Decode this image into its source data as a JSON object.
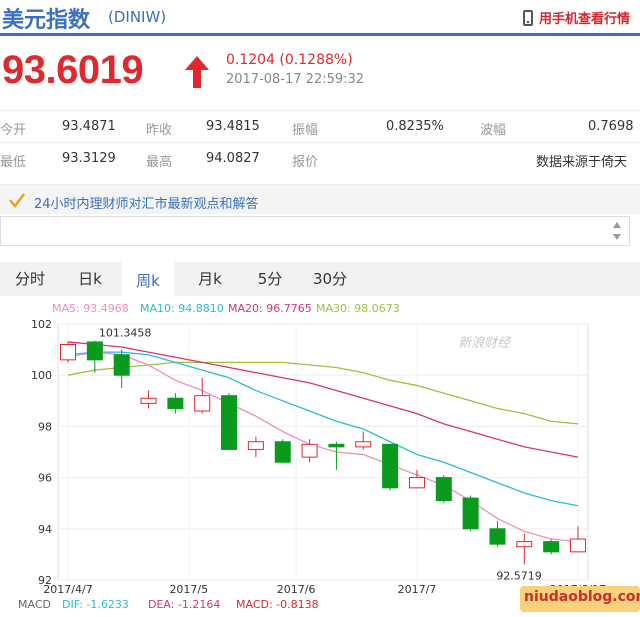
{
  "header": {
    "title": "美元指数",
    "code": "(DINIW)",
    "mobile_link": "用手机查看行情"
  },
  "quote": {
    "price": "93.6019",
    "change": "0.1204 (0.1288%)",
    "time": "2017-08-17 22:59:32",
    "direction": "up"
  },
  "stats": {
    "open_label": "今开",
    "open": "93.4871",
    "prev_close_label": "昨收",
    "prev_close": "93.4815",
    "amplitude_label": "振幅",
    "amplitude": "0.8235%",
    "wave_label": "波幅",
    "wave": "0.7698",
    "low_label": "最低",
    "low": "93.3129",
    "high_label": "最高",
    "high": "94.0827",
    "quote_label": "报价",
    "source": "数据来源于倚天"
  },
  "news": {
    "headline": "24小时内理财师对汇市最新观点和解答"
  },
  "tabs": [
    {
      "label": "分时"
    },
    {
      "label": "日k"
    },
    {
      "label": "周k"
    },
    {
      "label": "月k"
    },
    {
      "label": "5分"
    },
    {
      "label": "30分"
    }
  ],
  "active_tab": 2,
  "legend": {
    "ma5": "MA5: 93.4968",
    "ma10": "MA10: 94.8810",
    "ma20": "MA20: 96.7765",
    "ma30": "MA30: 98.0673"
  },
  "colors": {
    "ma5": "#f08cc0",
    "ma10": "#28bcd8",
    "ma20": "#d8337a",
    "ma30": "#9cc23c",
    "up": "#e0282e",
    "down": "#0a9a1e",
    "accent": "#3b6fbf"
  },
  "watermark": "新浪财经",
  "site_watermark": "niudaoblog.com",
  "macd": {
    "label": "MACD",
    "dif": "DIF: -1.6233",
    "dea": "DEA: -1.2164",
    "macd": "MACD: -0.8138"
  },
  "chart_data": {
    "type": "candlestick",
    "ylim": [
      92,
      102
    ],
    "yticks": [
      "102",
      "100",
      "98",
      "96",
      "94",
      "92"
    ],
    "x_labels": [
      "2017/4/7",
      "2017/5",
      "2017/6",
      "2017/7",
      "2017/8/17"
    ],
    "annotations": {
      "high": "101.3458",
      "low": "92.5719"
    },
    "candles": [
      {
        "o": 100.6,
        "c": 101.2,
        "h": 101.3,
        "l": 100.5
      },
      {
        "o": 101.3,
        "c": 100.6,
        "h": 101.35,
        "l": 100.1
      },
      {
        "o": 100.8,
        "c": 100.0,
        "h": 101.0,
        "l": 99.5
      },
      {
        "o": 98.9,
        "c": 99.1,
        "h": 99.4,
        "l": 98.7
      },
      {
        "o": 99.1,
        "c": 98.7,
        "h": 99.3,
        "l": 98.5
      },
      {
        "o": 98.6,
        "c": 99.2,
        "h": 99.9,
        "l": 98.5
      },
      {
        "o": 99.2,
        "c": 97.1,
        "h": 99.3,
        "l": 97.1
      },
      {
        "o": 97.1,
        "c": 97.4,
        "h": 97.6,
        "l": 96.8
      },
      {
        "o": 97.4,
        "c": 96.6,
        "h": 97.5,
        "l": 96.6
      },
      {
        "o": 96.8,
        "c": 97.3,
        "h": 97.5,
        "l": 96.6
      },
      {
        "o": 97.3,
        "c": 97.2,
        "h": 97.4,
        "l": 96.3
      },
      {
        "o": 97.2,
        "c": 97.4,
        "h": 97.8,
        "l": 97.1
      },
      {
        "o": 97.3,
        "c": 95.6,
        "h": 97.3,
        "l": 95.5
      },
      {
        "o": 95.6,
        "c": 96.0,
        "h": 96.3,
        "l": 95.6
      },
      {
        "o": 96.0,
        "c": 95.1,
        "h": 96.1,
        "l": 95.0
      },
      {
        "o": 95.2,
        "c": 94.0,
        "h": 95.3,
        "l": 93.9
      },
      {
        "o": 94.0,
        "c": 93.4,
        "h": 94.3,
        "l": 93.3
      },
      {
        "o": 93.3,
        "c": 93.5,
        "h": 93.8,
        "l": 92.6
      },
      {
        "o": 93.5,
        "c": 93.1,
        "h": 93.6,
        "l": 93.0
      },
      {
        "o": 93.1,
        "c": 93.6,
        "h": 94.1,
        "l": 93.1
      }
    ],
    "ma5": [
      100.7,
      100.9,
      100.8,
      100.4,
      99.8,
      99.4,
      98.9,
      98.4,
      97.8,
      97.3,
      97.0,
      96.9,
      96.5,
      96.1,
      95.7,
      95.1,
      94.4,
      93.9,
      93.6,
      93.5
    ],
    "ma10": [
      100.8,
      100.9,
      100.9,
      100.8,
      100.5,
      100.2,
      99.9,
      99.4,
      99.0,
      98.6,
      98.2,
      97.9,
      97.4,
      96.9,
      96.6,
      96.2,
      95.8,
      95.4,
      95.1,
      94.9
    ],
    "ma20": [
      101.3,
      101.2,
      101.1,
      100.9,
      100.7,
      100.5,
      100.3,
      100.1,
      99.9,
      99.7,
      99.4,
      99.1,
      98.8,
      98.5,
      98.1,
      97.8,
      97.5,
      97.2,
      97.0,
      96.8
    ],
    "ma30": [
      100.0,
      100.2,
      100.3,
      100.4,
      100.5,
      100.5,
      100.5,
      100.5,
      100.5,
      100.4,
      100.3,
      100.1,
      99.8,
      99.6,
      99.3,
      99.0,
      98.7,
      98.5,
      98.2,
      98.1
    ]
  }
}
